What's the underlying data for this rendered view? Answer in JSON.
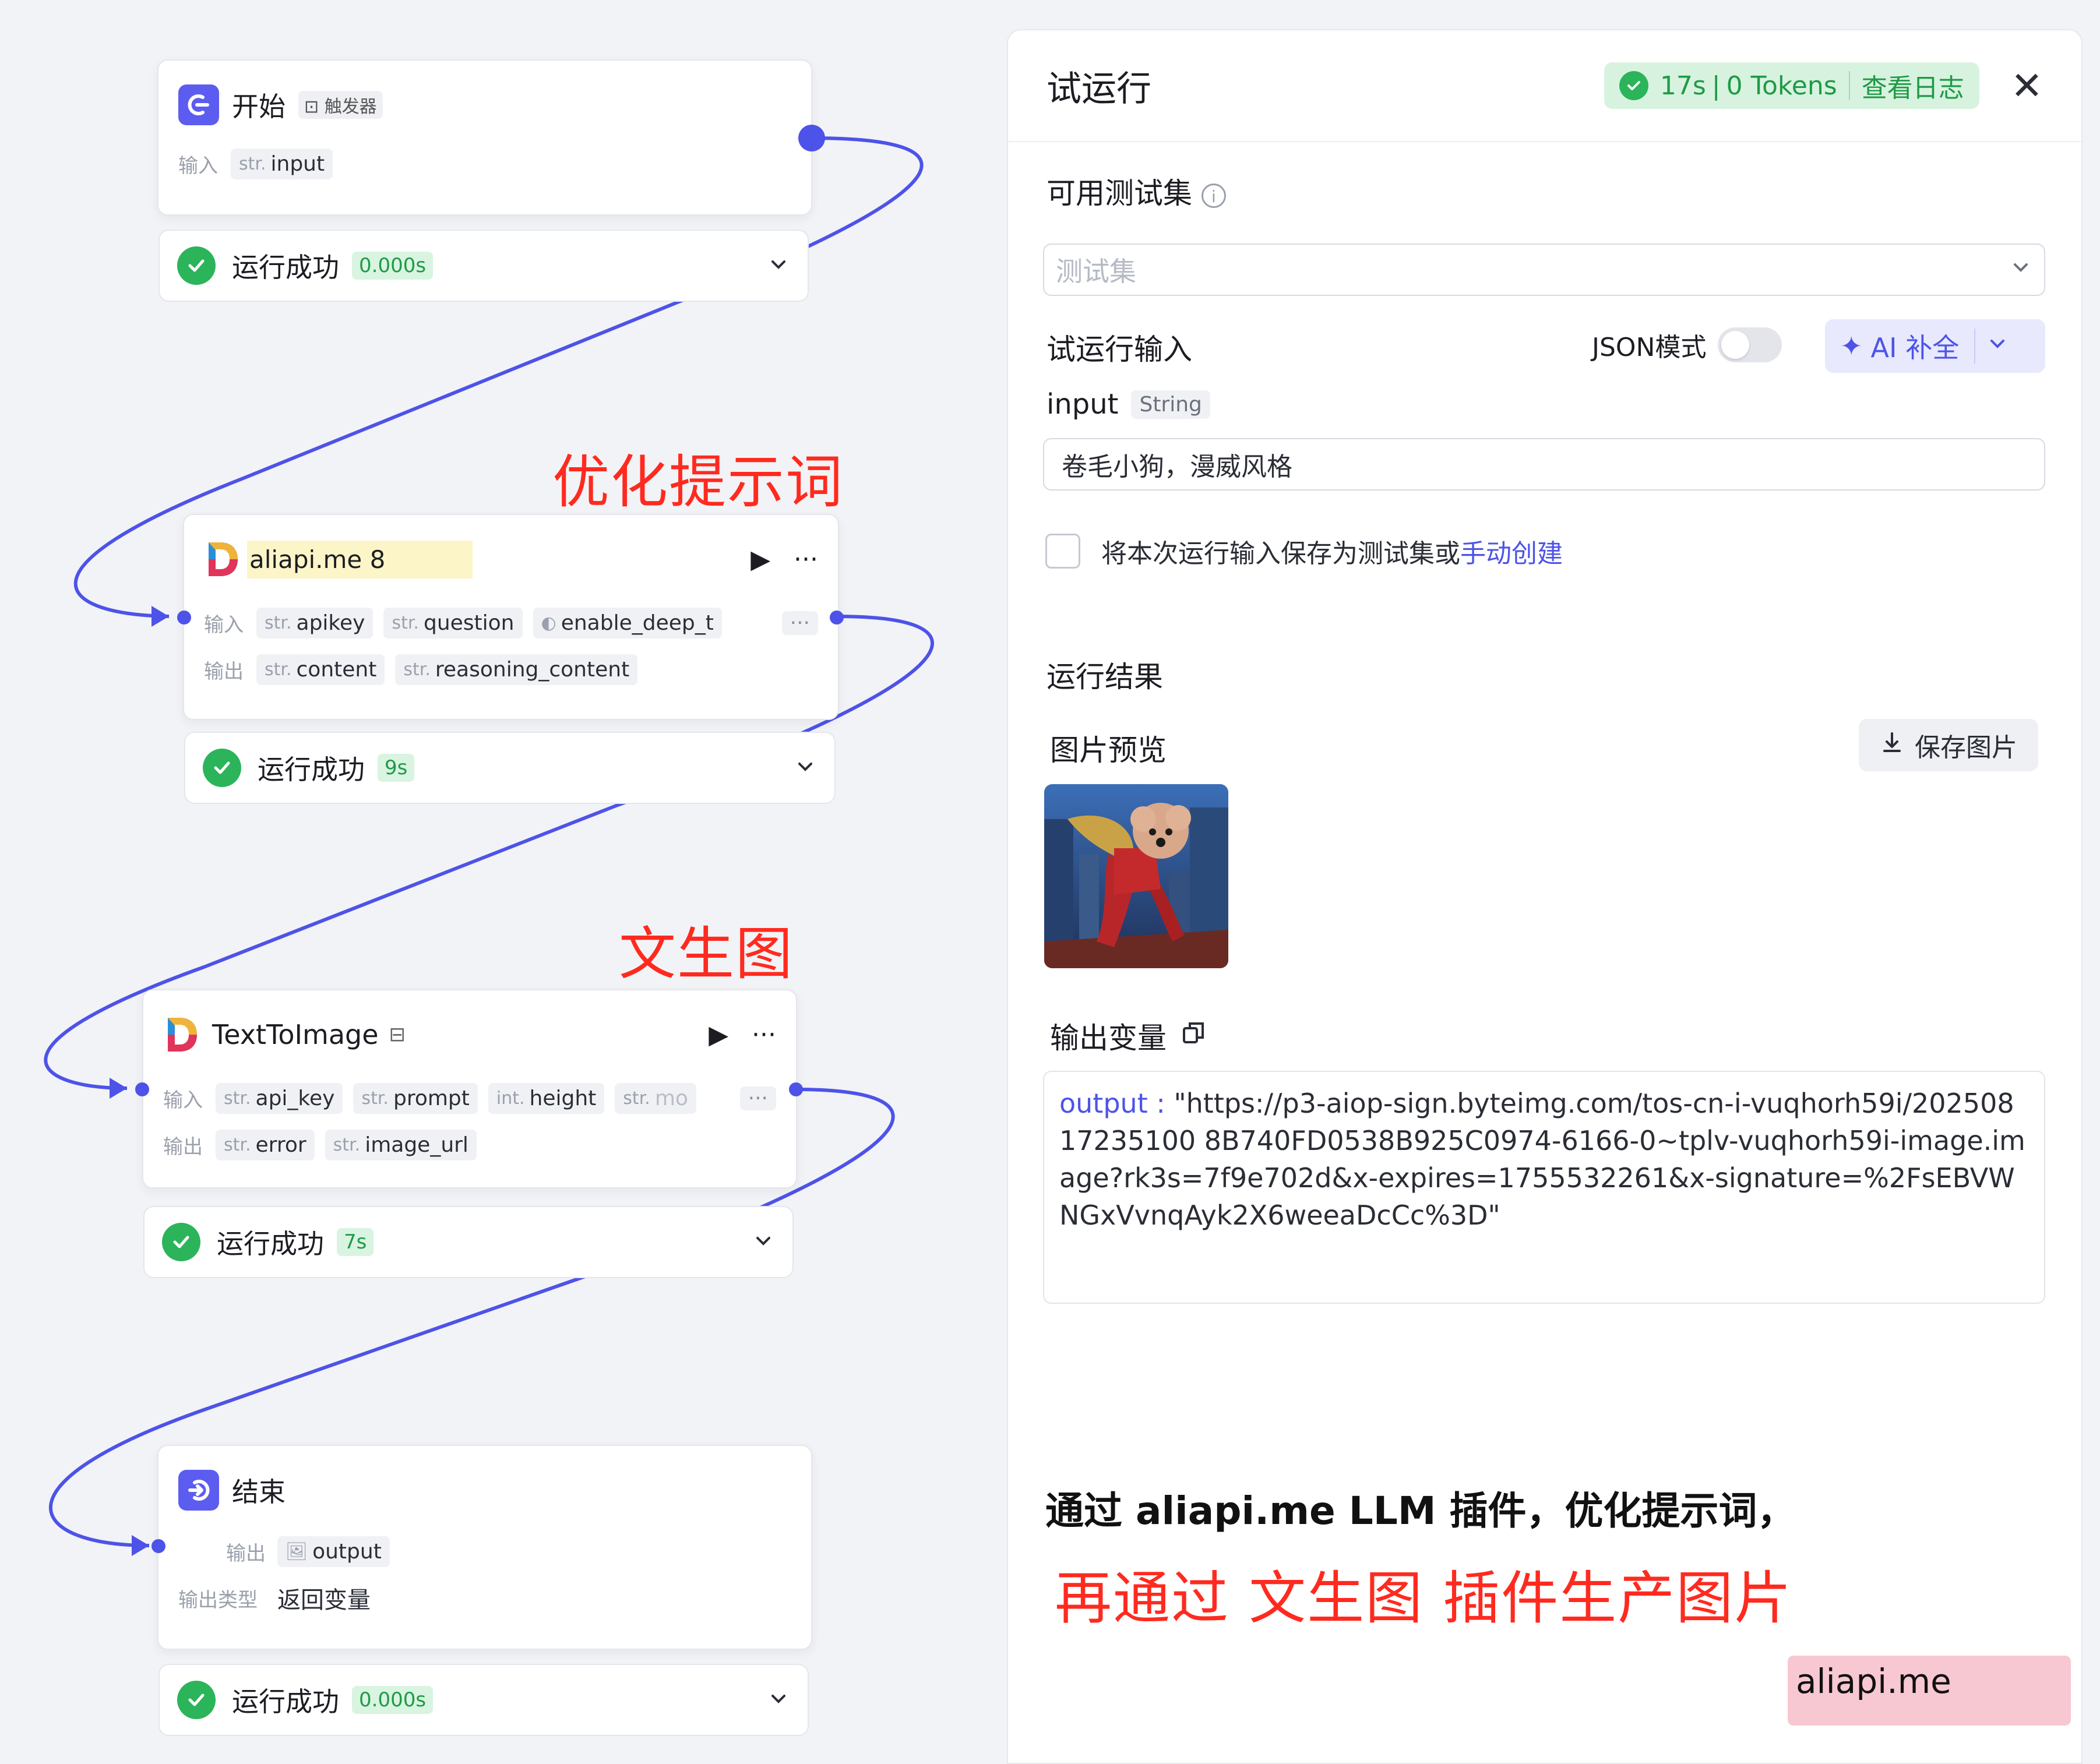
{
  "canvas": {
    "start_node": {
      "title": "开始",
      "trigger_tag": "触发器",
      "input_label": "输入",
      "input_var": {
        "type": "str.",
        "name": "input"
      },
      "status": {
        "text": "运行成功",
        "time": "0.000s"
      }
    },
    "llm_node": {
      "annotation": "优化提示词",
      "title": "aliapi.me 8",
      "input_label": "输入",
      "output_label": "输出",
      "inputs": [
        {
          "type": "str.",
          "name": "apikey"
        },
        {
          "type": "str.",
          "name": "question"
        },
        {
          "type": "",
          "name": "enable_deep_t"
        }
      ],
      "outputs": [
        {
          "type": "str.",
          "name": "content"
        },
        {
          "type": "str.",
          "name": "reasoning_content"
        }
      ],
      "more": "···",
      "status": {
        "text": "运行成功",
        "time": "9s"
      }
    },
    "t2i_node": {
      "annotation": "文生图",
      "title": "TextToImage",
      "input_label": "输入",
      "output_label": "输出",
      "inputs": [
        {
          "type": "str.",
          "name": "api_key"
        },
        {
          "type": "str.",
          "name": "prompt"
        },
        {
          "type": "int.",
          "name": "height"
        },
        {
          "type": "str.",
          "name": "mo"
        }
      ],
      "outputs": [
        {
          "type": "str.",
          "name": "error"
        },
        {
          "type": "str.",
          "name": "image_url"
        }
      ],
      "more": "···",
      "status": {
        "text": "运行成功",
        "time": "7s"
      }
    },
    "end_node": {
      "title": "结束",
      "output_label": "输出",
      "output_var": "output",
      "type_label": "输出类型",
      "type_value": "返回变量",
      "status": {
        "text": "运行成功",
        "time": "0.000s"
      }
    }
  },
  "panel": {
    "title": "试运行",
    "badge": {
      "duration": "17s",
      "tokens": "0 Tokens",
      "log_link": "查看日志"
    },
    "test_set_label": "可用测试集",
    "test_set_placeholder": "测试集",
    "run_input_label": "试运行输入",
    "json_mode_label": "JSON模式",
    "ai_button": "AI 补全",
    "input_name": "input",
    "input_type": "String",
    "input_value": "卷毛小狗，漫威风格",
    "save_checkbox_text": "将本次运行输入保存为测试集或",
    "manual_create_link": "手动创建",
    "result_label": "运行结果",
    "preview_label": "图片预览",
    "save_image_button": "保存图片",
    "output_var_label": "输出变量",
    "output_key": "output :",
    "output_value": "\"https://p3-aiop-sign.byteimg.com/tos-cn-i-vuqhorh59i/20250817235100 8B740FD0538B925C0974-6166-0~tplv-vuqhorh59i-image.image?rk3s=7f9e702d&x-expires=1755532261&x-signature=%2FsEBVWNGxVvnqAyk2X6weeaDcCc%3D\""
  },
  "caption": {
    "line1": "通过 aliapi.me LLM 插件，优化提示词，",
    "line2": "再通过 文生图 插件生产图片"
  },
  "watermark": "aliapi.me",
  "colors": {
    "accent": "#4d53e8",
    "success": "#2bb45a",
    "annotation_red": "#ff2a1f"
  }
}
